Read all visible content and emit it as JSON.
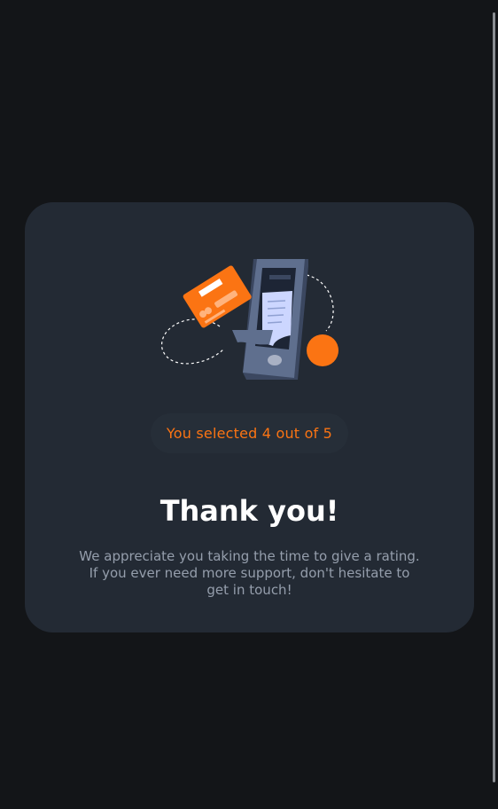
{
  "badge": {
    "text": "You selected 4 out of 5"
  },
  "heading": {
    "text": "Thank you!"
  },
  "description": {
    "text": "We appreciate you taking the time to give a rating. If you ever need more support, don't hesitate to get in touch!"
  },
  "rating": {
    "selected": 4,
    "max": 5
  },
  "colors": {
    "background": "#131518",
    "card": "#232a34",
    "accent": "#fb7413",
    "heading": "#ffffff",
    "body_text": "#959eac"
  },
  "icons": {
    "illustration": "phone-receipt-card-illustration"
  }
}
